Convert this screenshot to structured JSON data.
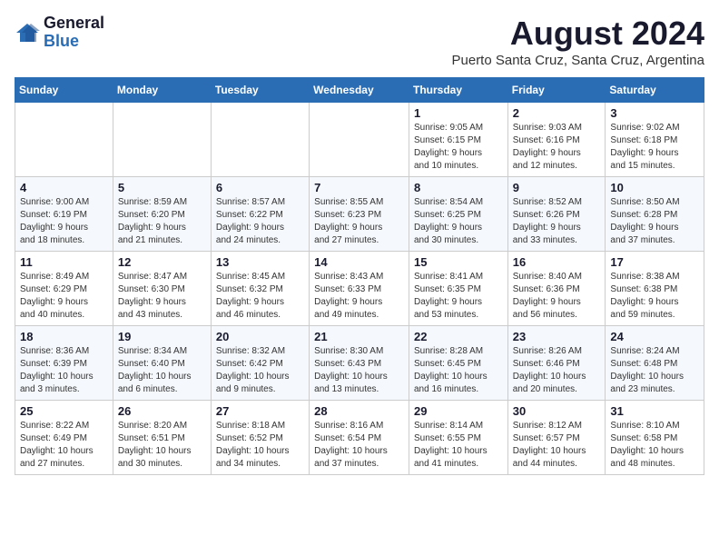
{
  "logo": {
    "line1": "General",
    "line2": "Blue"
  },
  "title": "August 2024",
  "subtitle": "Puerto Santa Cruz, Santa Cruz, Argentina",
  "days_of_week": [
    "Sunday",
    "Monday",
    "Tuesday",
    "Wednesday",
    "Thursday",
    "Friday",
    "Saturday"
  ],
  "weeks": [
    [
      {
        "day": "",
        "info": ""
      },
      {
        "day": "",
        "info": ""
      },
      {
        "day": "",
        "info": ""
      },
      {
        "day": "",
        "info": ""
      },
      {
        "day": "1",
        "info": "Sunrise: 9:05 AM\nSunset: 6:15 PM\nDaylight: 9 hours\nand 10 minutes."
      },
      {
        "day": "2",
        "info": "Sunrise: 9:03 AM\nSunset: 6:16 PM\nDaylight: 9 hours\nand 12 minutes."
      },
      {
        "day": "3",
        "info": "Sunrise: 9:02 AM\nSunset: 6:18 PM\nDaylight: 9 hours\nand 15 minutes."
      }
    ],
    [
      {
        "day": "4",
        "info": "Sunrise: 9:00 AM\nSunset: 6:19 PM\nDaylight: 9 hours\nand 18 minutes."
      },
      {
        "day": "5",
        "info": "Sunrise: 8:59 AM\nSunset: 6:20 PM\nDaylight: 9 hours\nand 21 minutes."
      },
      {
        "day": "6",
        "info": "Sunrise: 8:57 AM\nSunset: 6:22 PM\nDaylight: 9 hours\nand 24 minutes."
      },
      {
        "day": "7",
        "info": "Sunrise: 8:55 AM\nSunset: 6:23 PM\nDaylight: 9 hours\nand 27 minutes."
      },
      {
        "day": "8",
        "info": "Sunrise: 8:54 AM\nSunset: 6:25 PM\nDaylight: 9 hours\nand 30 minutes."
      },
      {
        "day": "9",
        "info": "Sunrise: 8:52 AM\nSunset: 6:26 PM\nDaylight: 9 hours\nand 33 minutes."
      },
      {
        "day": "10",
        "info": "Sunrise: 8:50 AM\nSunset: 6:28 PM\nDaylight: 9 hours\nand 37 minutes."
      }
    ],
    [
      {
        "day": "11",
        "info": "Sunrise: 8:49 AM\nSunset: 6:29 PM\nDaylight: 9 hours\nand 40 minutes."
      },
      {
        "day": "12",
        "info": "Sunrise: 8:47 AM\nSunset: 6:30 PM\nDaylight: 9 hours\nand 43 minutes."
      },
      {
        "day": "13",
        "info": "Sunrise: 8:45 AM\nSunset: 6:32 PM\nDaylight: 9 hours\nand 46 minutes."
      },
      {
        "day": "14",
        "info": "Sunrise: 8:43 AM\nSunset: 6:33 PM\nDaylight: 9 hours\nand 49 minutes."
      },
      {
        "day": "15",
        "info": "Sunrise: 8:41 AM\nSunset: 6:35 PM\nDaylight: 9 hours\nand 53 minutes."
      },
      {
        "day": "16",
        "info": "Sunrise: 8:40 AM\nSunset: 6:36 PM\nDaylight: 9 hours\nand 56 minutes."
      },
      {
        "day": "17",
        "info": "Sunrise: 8:38 AM\nSunset: 6:38 PM\nDaylight: 9 hours\nand 59 minutes."
      }
    ],
    [
      {
        "day": "18",
        "info": "Sunrise: 8:36 AM\nSunset: 6:39 PM\nDaylight: 10 hours\nand 3 minutes."
      },
      {
        "day": "19",
        "info": "Sunrise: 8:34 AM\nSunset: 6:40 PM\nDaylight: 10 hours\nand 6 minutes."
      },
      {
        "day": "20",
        "info": "Sunrise: 8:32 AM\nSunset: 6:42 PM\nDaylight: 10 hours\nand 9 minutes."
      },
      {
        "day": "21",
        "info": "Sunrise: 8:30 AM\nSunset: 6:43 PM\nDaylight: 10 hours\nand 13 minutes."
      },
      {
        "day": "22",
        "info": "Sunrise: 8:28 AM\nSunset: 6:45 PM\nDaylight: 10 hours\nand 16 minutes."
      },
      {
        "day": "23",
        "info": "Sunrise: 8:26 AM\nSunset: 6:46 PM\nDaylight: 10 hours\nand 20 minutes."
      },
      {
        "day": "24",
        "info": "Sunrise: 8:24 AM\nSunset: 6:48 PM\nDaylight: 10 hours\nand 23 minutes."
      }
    ],
    [
      {
        "day": "25",
        "info": "Sunrise: 8:22 AM\nSunset: 6:49 PM\nDaylight: 10 hours\nand 27 minutes."
      },
      {
        "day": "26",
        "info": "Sunrise: 8:20 AM\nSunset: 6:51 PM\nDaylight: 10 hours\nand 30 minutes."
      },
      {
        "day": "27",
        "info": "Sunrise: 8:18 AM\nSunset: 6:52 PM\nDaylight: 10 hours\nand 34 minutes."
      },
      {
        "day": "28",
        "info": "Sunrise: 8:16 AM\nSunset: 6:54 PM\nDaylight: 10 hours\nand 37 minutes."
      },
      {
        "day": "29",
        "info": "Sunrise: 8:14 AM\nSunset: 6:55 PM\nDaylight: 10 hours\nand 41 minutes."
      },
      {
        "day": "30",
        "info": "Sunrise: 8:12 AM\nSunset: 6:57 PM\nDaylight: 10 hours\nand 44 minutes."
      },
      {
        "day": "31",
        "info": "Sunrise: 8:10 AM\nSunset: 6:58 PM\nDaylight: 10 hours\nand 48 minutes."
      }
    ]
  ]
}
